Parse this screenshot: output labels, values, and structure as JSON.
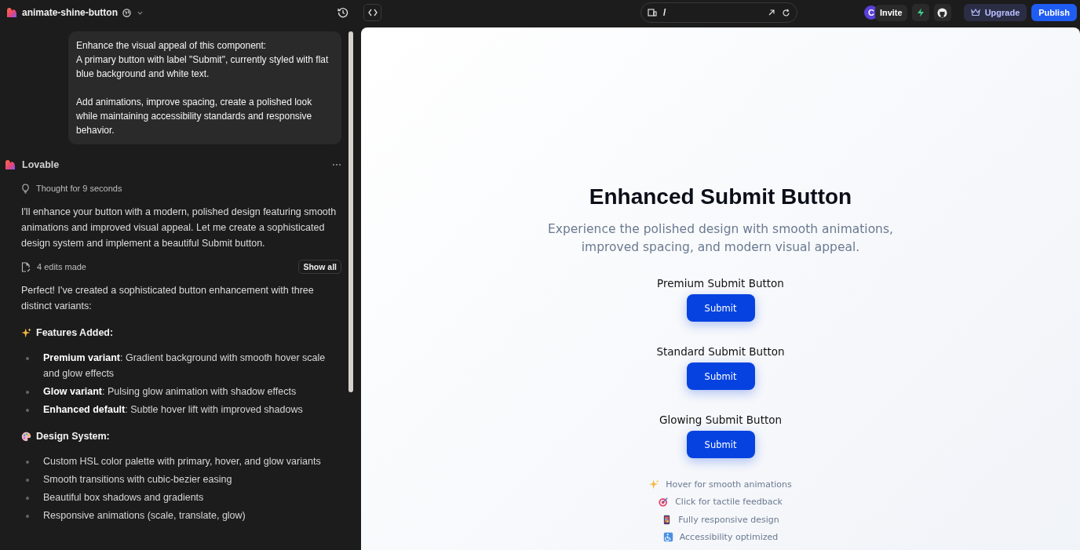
{
  "project": {
    "name": "animate-shine-button"
  },
  "chat": {
    "user_message": [
      "Enhance the visual appeal of this component:\nA primary button with label \"Submit\", currently styled with flat blue background and white text.",
      "Add animations, improve spacing, create a polished look while maintaining accessibility standards and responsive behavior."
    ],
    "assistant_name": "Lovable",
    "thought": "Thought for 9 seconds",
    "intro": "I'll enhance your button with a modern, polished design featuring smooth animations and improved visual appeal. Let me create a sophisticated design system and implement a beautiful Submit button.",
    "edits": {
      "label": "4 edits made",
      "button": "Show all"
    },
    "summary": "Perfect! I've created a sophisticated button enhancement with three distinct variants:",
    "sections": [
      {
        "kind": "sparkles",
        "heading": "Features Added:",
        "items": [
          "**Premium variant**: Gradient background with smooth hover scale and glow effects",
          "**Glow variant**: Pulsing glow animation with shadow effects",
          "**Enhanced default**: Subtle hover lift with improved shadows"
        ]
      },
      {
        "kind": "palette",
        "heading": "Design System:",
        "items": [
          "Custom HSL color palette with primary, hover, and glow variants",
          "Smooth transitions with cubic-bezier easing",
          "Beautiful box shadows and gradients",
          "Responsive animations (scale, translate, glow)"
        ]
      }
    ]
  },
  "toolbar": {
    "url": "/",
    "avatar": "C",
    "invite": "Invite",
    "upgrade": "Upgrade",
    "publish": "Publish"
  },
  "preview": {
    "title": "Enhanced Submit Button",
    "subtitle": "Experience the polished design with smooth animations, improved spacing, and modern visual appeal.",
    "variants": [
      {
        "label": "Premium Submit Button",
        "button": "Submit"
      },
      {
        "label": "Standard Submit Button",
        "button": "Submit"
      },
      {
        "label": "Glowing Submit Button",
        "button": "Submit"
      }
    ],
    "features": [
      {
        "kind": "sparkles",
        "text": "Hover for smooth animations"
      },
      {
        "kind": "target",
        "text": "Click for tactile feedback"
      },
      {
        "kind": "phone",
        "text": "Fully responsive design"
      },
      {
        "kind": "accessibility",
        "text": "Accessibility optimized"
      }
    ]
  }
}
